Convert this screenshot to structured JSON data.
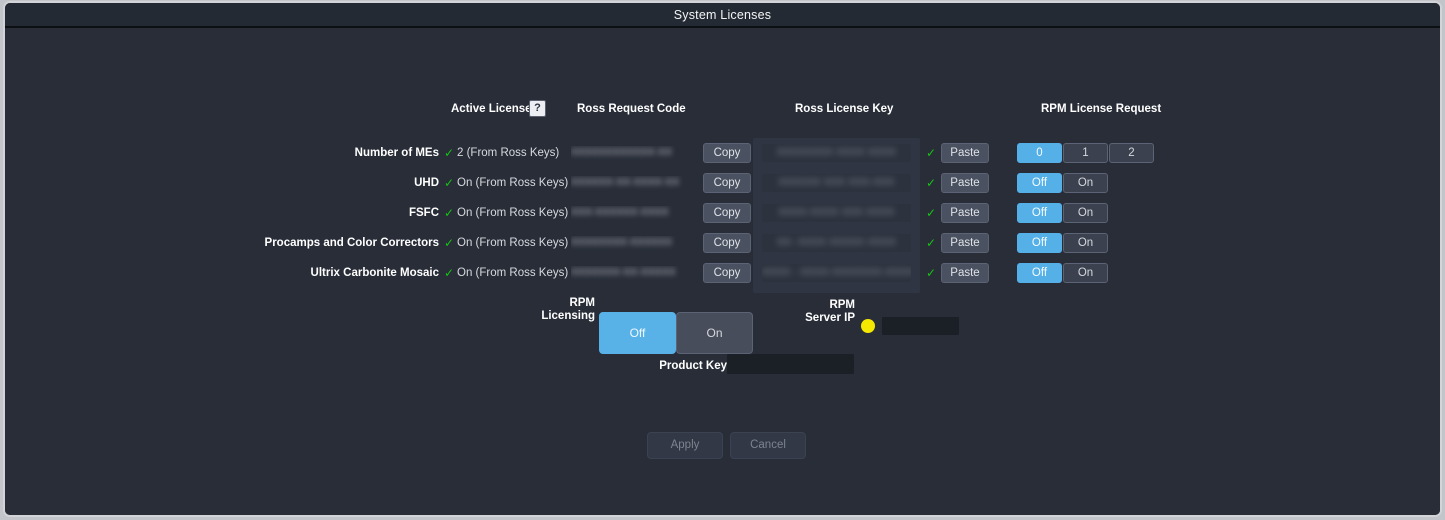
{
  "window": {
    "title": "System Licenses"
  },
  "headers": {
    "active_licenses": "Active Licenses",
    "help_icon_label": "?",
    "ross_request_code": "Ross Request Code",
    "ross_license_key": "Ross License Key",
    "rpm_license_request": "RPM License Request"
  },
  "rows": [
    {
      "label": "Number of MEs",
      "check": "✓",
      "active_value": "2 (From Ross Keys)",
      "request_code": "XXXXXXXXXXXX-XX",
      "copy_label": "Copy",
      "license_key": "XXXXXXXX  XXXX  XXXX",
      "key_check": "✓",
      "paste_label": "Paste",
      "rpm_options": [
        "0",
        "1",
        "2"
      ],
      "rpm_selected": "0"
    },
    {
      "label": "UHD",
      "check": "✓",
      "active_value": "On (From Ross Keys)",
      "request_code": "XXXXXX-XX-XXXX-XX",
      "copy_label": "Copy",
      "license_key": "XXXXXX  XXX      XXX-XXX",
      "key_check": "✓",
      "paste_label": "Paste",
      "rpm_options": [
        "Off",
        "On"
      ],
      "rpm_selected": "Off"
    },
    {
      "label": "FSFC",
      "check": "✓",
      "active_value": "On (From Ross Keys)",
      "request_code": "XXX-XXXXXX-XXXX",
      "copy_label": "Copy",
      "license_key": "XXXX-XXXX   XXX  XXXX",
      "key_check": "✓",
      "paste_label": "Paste",
      "rpm_options": [
        "Off",
        "On"
      ],
      "rpm_selected": "Off"
    },
    {
      "label": "Procamps and Color Correctors",
      "check": "✓",
      "active_value": "On (From Ross Keys)",
      "request_code": "XXXXXXXX-XXXXXX",
      "copy_label": "Copy",
      "license_key": "XX-  XXXX XXXXX  XXXX",
      "key_check": "✓",
      "paste_label": "Paste",
      "rpm_options": [
        "Off",
        "On"
      ],
      "rpm_selected": "Off"
    },
    {
      "label": "Ultrix Carbonite Mosaic",
      "check": "✓",
      "active_value": "On (From Ross Keys)",
      "request_code": "XXXXXXX-XX-XXXXX",
      "copy_label": "Copy",
      "license_key": "XXXX - XXXX-XXXXXXX-XXXX",
      "key_check": "✓",
      "paste_label": "Paste",
      "rpm_options": [
        "Off",
        "On"
      ],
      "rpm_selected": "Off"
    }
  ],
  "rpm_licensing": {
    "label_line1": "RPM",
    "label_line2": "Licensing",
    "options": [
      "Off",
      "On"
    ],
    "selected": "Off",
    "off_label": "Off",
    "on_label": "On"
  },
  "rpm_server_ip": {
    "label_line1": "RPM",
    "label_line2": "Server IP",
    "status_color": "#f5e800",
    "value": ""
  },
  "product_key": {
    "label": "Product Key",
    "value": ""
  },
  "footer": {
    "apply_label": "Apply",
    "cancel_label": "Cancel"
  },
  "colors": {
    "accent": "#55b0e8",
    "check_green": "#15c415",
    "status_yellow": "#f5e800",
    "window_bg": "#282d38",
    "panel_bg": "#2f3542"
  }
}
